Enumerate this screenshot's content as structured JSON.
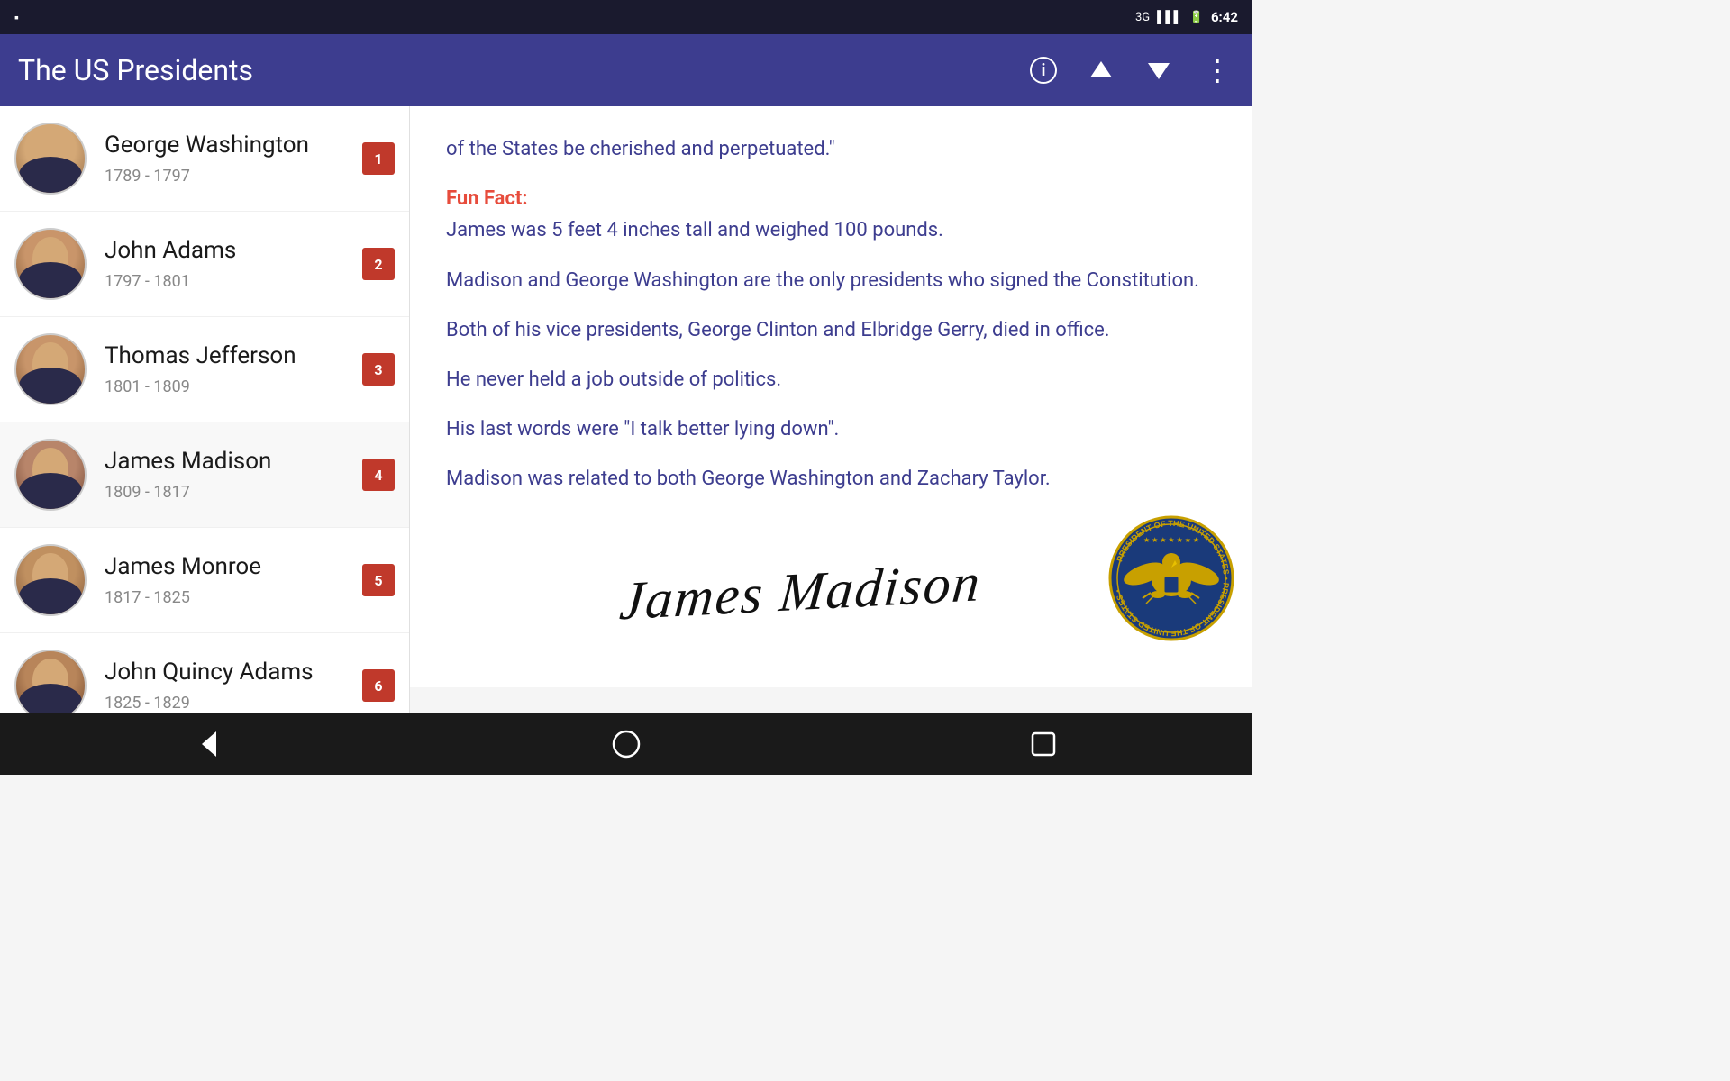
{
  "statusBar": {
    "signal": "3G",
    "time": "6:42",
    "battery": "🔋"
  },
  "appBar": {
    "title": "The US Presidents",
    "actions": [
      "info",
      "up",
      "down",
      "more"
    ]
  },
  "presidents": [
    {
      "id": 1,
      "name": "George Washington",
      "years": "1789 - 1797",
      "number": "1",
      "avatarClass": "avatar-gw"
    },
    {
      "id": 2,
      "name": "John Adams",
      "years": "1797 - 1801",
      "number": "2",
      "avatarClass": "avatar-ja"
    },
    {
      "id": 3,
      "name": "Thomas Jefferson",
      "years": "1801 - 1809",
      "number": "3",
      "avatarClass": "avatar-tj"
    },
    {
      "id": 4,
      "name": "James Madison",
      "years": "1809 - 1817",
      "number": "4",
      "avatarClass": "avatar-jm",
      "selected": true
    },
    {
      "id": 5,
      "name": "James Monroe",
      "years": "1817 - 1825",
      "number": "5",
      "avatarClass": "avatar-jmo"
    },
    {
      "id": 6,
      "name": "John Quincy Adams",
      "years": "1825 - 1829",
      "number": "6",
      "avatarClass": "avatar-jqa"
    }
  ],
  "detail": {
    "quoteEnd": "of the States be cherished and perpetuated.\"",
    "funFactLabel": "Fun Fact:",
    "funFact": "James was 5 feet 4 inches tall and weighed 100 pounds.",
    "fact1": "Madison and George Washington are the only presidents who signed the Constitution.",
    "fact2": "Both of his vice presidents, George Clinton and Elbridge Gerry, died in office.",
    "fact3": "He never held a job outside of politics.",
    "fact4": "His last words were \"I talk better lying down\".",
    "fact5": "Madison was related to both George Washington and Zachary Taylor.",
    "signature": "James Madison"
  },
  "bottomNav": {
    "back": "◁",
    "home": "○",
    "recent": "□"
  }
}
